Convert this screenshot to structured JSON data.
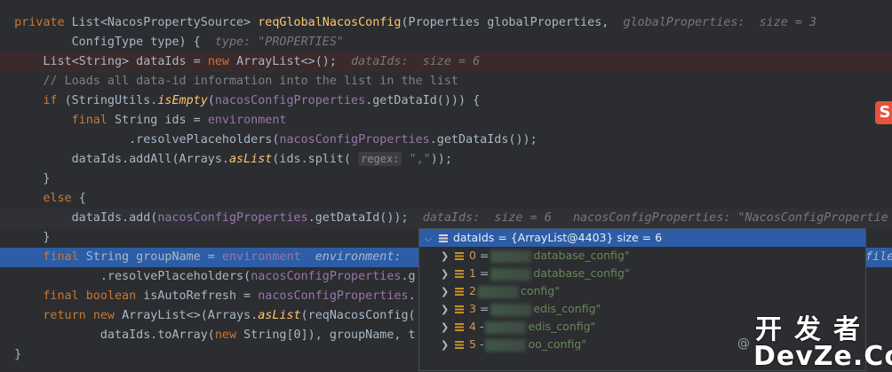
{
  "code": {
    "l1": {
      "private": "private ",
      "type1": "List<NacosPropertySource> ",
      "method": "reqGlobalNacosConfig",
      "params": "(Properties globalProperties,",
      "hint": "globalProperties:  size = 3"
    },
    "l2": {
      "type": "ConfigType type) {",
      "hint": "type: \"PROPERTIES\""
    },
    "l3": {
      "decl": "List<String> dataIds = ",
      "new": "new ",
      "ctor": "ArrayList<>();",
      "hint": "dataIds:  size = 6"
    },
    "l4": {
      "comment": "// Loads all data-id information into the list in the list"
    },
    "l5": {
      "if": "if ",
      "a": "(StringUtils.",
      "isEmpty": "isEmpty",
      "b": "(",
      "fld": "nacosConfigProperties",
      "c": ".getDataId())) {"
    },
    "l6": {
      "final": "final ",
      "a": "String ids = ",
      "env": "environment"
    },
    "l7": {
      "a": ".resolvePlaceholders(",
      "fld": "nacosConfigProperties",
      "b": ".getDataIds());"
    },
    "l8": {
      "a": "dataIds.addAll(Arrays.",
      "asList": "asList",
      "b": "(ids.split( ",
      "regex": "regex:",
      "c": " \",\"",
      "d": "));"
    },
    "l9": {
      "brace": "}"
    },
    "l10": {
      "else": "else ",
      "brace": "{"
    },
    "l11": {
      "a": "dataIds.add(",
      "fld": "nacosConfigProperties",
      "b": ".getDataId());",
      "hint1": "dataIds:  size = 6",
      "hint2": "nacosConfigProperties: \"NacosConfigPropertie"
    },
    "l12": {
      "brace": "}"
    },
    "l13": {
      "final": "final ",
      "a": "String groupName = ",
      "env": "environment",
      "hint": "environment:",
      "right": "file"
    },
    "l14": {
      "a": ".resolvePlaceholders(",
      "fld": "nacosConfigProperties",
      "b": ".g"
    },
    "l15": {
      "final": "final ",
      "bool": "boolean ",
      "a": "isAutoRefresh = ",
      "fld": "nacosConfigProperties",
      "b": "."
    },
    "l16": {
      "ret": "return ",
      "new": "new ",
      "a": "ArrayList<>(Arrays.",
      "asList": "asList",
      "b": "(reqNacosConfig("
    },
    "l17": {
      "a": "dataIds.toArray(",
      "new": "new ",
      "b": "String[0]), groupName, t"
    },
    "l18": {
      "brace": "}"
    }
  },
  "debugger": {
    "header": "dataIds = {ArrayList@4403}  size = 6",
    "items": [
      {
        "index": "0",
        "sep": " =",
        "value": "database_config\""
      },
      {
        "index": "1",
        "sep": " =",
        "value": "database_config\""
      },
      {
        "index": "2",
        "sep": "",
        "value": "config\""
      },
      {
        "index": "3",
        "sep": " =",
        "value": "edis_config\""
      },
      {
        "index": "4",
        "sep": " -",
        "value": "edis_config\""
      },
      {
        "index": "5",
        "sep": " -",
        "value": "oo_config\""
      }
    ]
  },
  "watermark": {
    "at": "@",
    "line1": "开发者",
    "line2": "DevZe.CoM"
  },
  "colors": {
    "keyword": "#cc7832",
    "method": "#ffc66d",
    "field": "#9876aa",
    "string": "#6a8759",
    "comment": "#808080",
    "selection": "#2c5da6"
  }
}
